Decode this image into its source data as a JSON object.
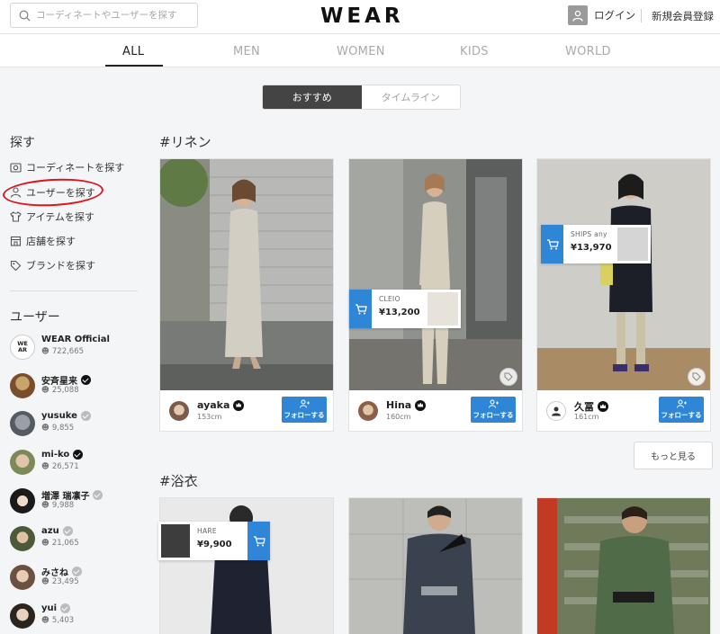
{
  "header": {
    "search_placeholder": "コーディネートやユーザーを探す",
    "logo": "WEAR",
    "login": "ログイン",
    "register": "新規会員登録"
  },
  "tabs": [
    {
      "label": "ALL",
      "active": true
    },
    {
      "label": "MEN",
      "active": false
    },
    {
      "label": "WOMEN",
      "active": false
    },
    {
      "label": "KIDS",
      "active": false
    },
    {
      "label": "WORLD",
      "active": false
    }
  ],
  "toggle": {
    "recommended": "おすすめ",
    "timeline": "タイムライン"
  },
  "sidebar": {
    "search_heading": "探す",
    "nav": [
      {
        "label": "コーディネートを探す",
        "icon": "photo-icon"
      },
      {
        "label": "ユーザーを探す",
        "icon": "user-icon"
      },
      {
        "label": "アイテムを探す",
        "icon": "shirt-icon"
      },
      {
        "label": "店舗を探す",
        "icon": "store-icon"
      },
      {
        "label": "ブランドを探す",
        "icon": "tag-icon"
      }
    ],
    "users_heading": "ユーザー",
    "users": [
      {
        "name": "WEAR Official",
        "followers": "722,665",
        "badge": "none",
        "avatar": "WE AR"
      },
      {
        "name": "安斉星来",
        "followers": "25,088",
        "badge": "black"
      },
      {
        "name": "yusuke",
        "followers": "9,855",
        "badge": "gray"
      },
      {
        "name": "mi-ko",
        "followers": "26,571",
        "badge": "black"
      },
      {
        "name": "増澤 瑞凛子",
        "followers": "9,988",
        "badge": "gray"
      },
      {
        "name": "azu",
        "followers": "21,065",
        "badge": "gray"
      },
      {
        "name": "みさね",
        "followers": "23,495",
        "badge": "gray"
      },
      {
        "name": "yui",
        "followers": "5,403",
        "badge": "gray"
      }
    ]
  },
  "sections": [
    {
      "title": "#リネン",
      "cards": [
        {
          "user": "ayaka",
          "height": "153cm",
          "follow": "フォローする"
        },
        {
          "user": "Hina",
          "height": "160cm",
          "follow": "フォローする",
          "tag": {
            "brand": "CLEIO",
            "price": "¥13,200"
          }
        },
        {
          "user": "久冨",
          "height": "161cm",
          "follow": "フォローする",
          "tag": {
            "brand": "SHIPS any",
            "price": "¥13,970"
          }
        }
      ]
    },
    {
      "title": "#浴衣",
      "cards": [
        {
          "tag": {
            "brand": "HARE",
            "price": "¥9,900"
          }
        }
      ]
    }
  ],
  "more_button": "もっと見る",
  "colors": {
    "accent": "#2f86d6",
    "annotation": "#e0141d"
  }
}
